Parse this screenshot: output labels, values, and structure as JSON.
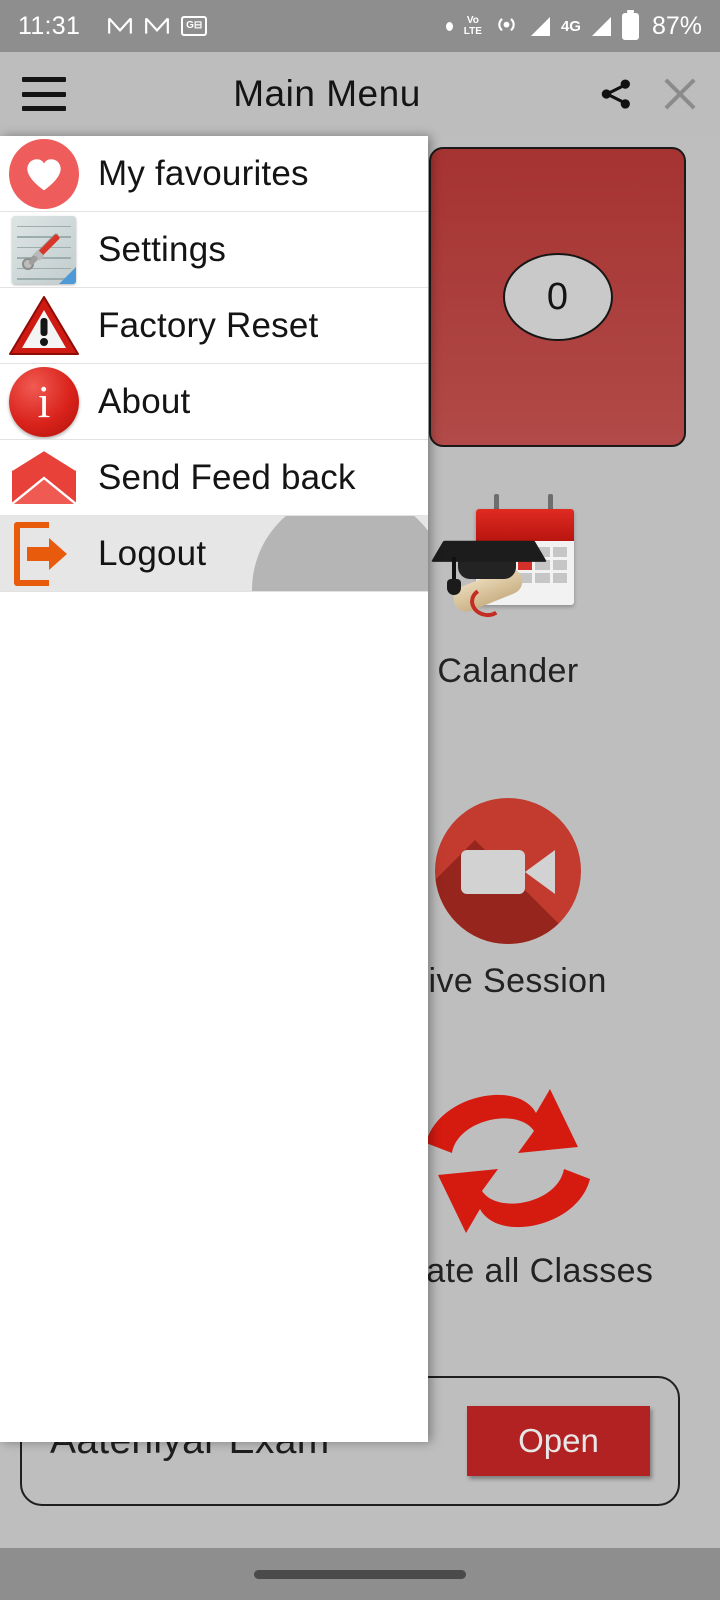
{
  "status_bar": {
    "time": "11:31",
    "icons": [
      "gmail-icon",
      "gmail-icon",
      "google-news-icon",
      "dot-icon",
      "volte-icon",
      "hotspot-icon",
      "signal-icon",
      "4g-icon",
      "signal-icon"
    ],
    "volte_top": "Vo",
    "volte_bottom": "LTE",
    "network_label": "4G",
    "battery_percent": "87%"
  },
  "app_bar": {
    "menu_icon": "hamburger-icon",
    "title": "Main Menu",
    "share_icon": "share-icon",
    "close_icon": "close-icon"
  },
  "drawer": {
    "items": [
      {
        "label": "My favourites",
        "icon": "heart-icon",
        "selected": false
      },
      {
        "label": "Settings",
        "icon": "tools-note-icon",
        "selected": false
      },
      {
        "label": "Factory Reset",
        "icon": "warning-triangle-icon",
        "selected": false
      },
      {
        "label": "About",
        "icon": "info-circle-icon",
        "selected": false
      },
      {
        "label": "Send Feed back",
        "icon": "envelope-icon",
        "selected": false
      },
      {
        "label": "Logout",
        "icon": "logout-arrow-icon",
        "selected": true
      }
    ]
  },
  "home": {
    "count_card": {
      "value": "0",
      "color": "#A53331"
    },
    "tiles": [
      {
        "label": "Calander",
        "icon": "graduation-calendar-icon"
      },
      {
        "label": "Live Session",
        "icon": "video-camera-icon"
      },
      {
        "label": "Update all Classes",
        "icon": "sync-arrows-icon"
      }
    ],
    "bottom_card": {
      "title": "Aateniyar Exam",
      "button_label": "Open",
      "button_color": "#B22222"
    }
  },
  "nav_bar": {
    "gesture_pill": "home-gesture-pill"
  }
}
